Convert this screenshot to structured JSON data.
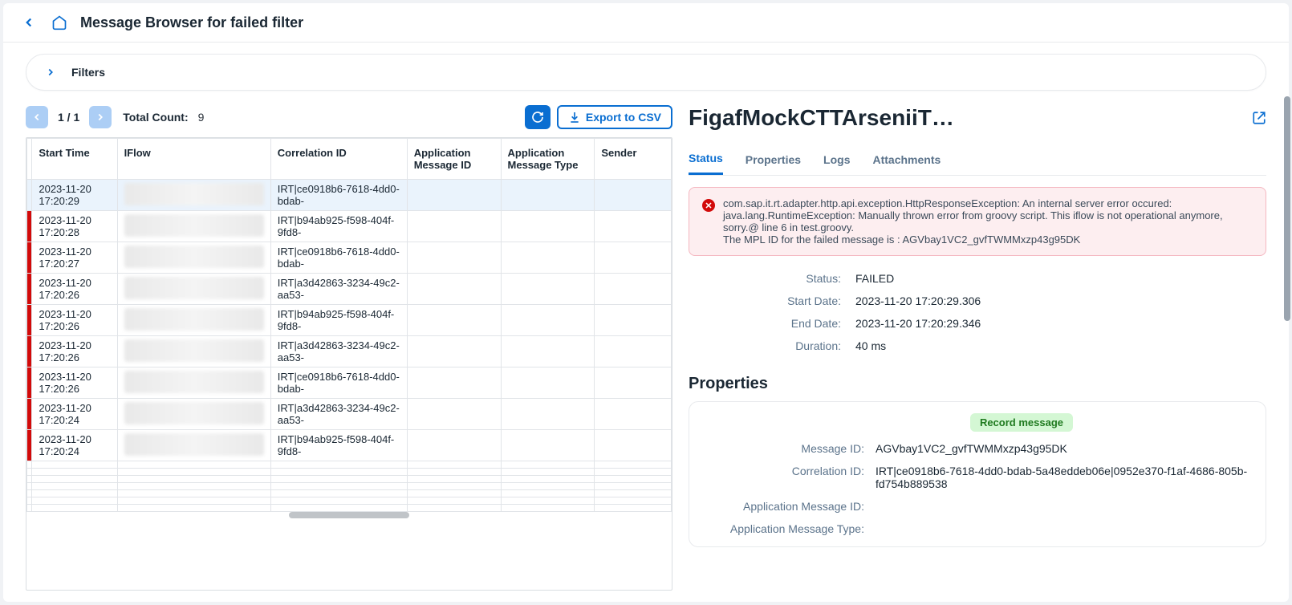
{
  "header": {
    "title": "Message Browser for failed filter"
  },
  "filters": {
    "label": "Filters"
  },
  "toolbar": {
    "pager": "1 / 1",
    "total_label": "Total Count:",
    "total_value": "9",
    "export_label": "Export to CSV"
  },
  "table": {
    "columns": [
      "Start Time",
      "IFlow",
      "Correlation ID",
      "Application Message ID",
      "Application Message Type",
      "Sender"
    ],
    "rows": [
      {
        "start": "2023-11-20 17:20:29",
        "corr": "IRT|ce0918b6-7618-4dd0-bdab-"
      },
      {
        "start": "2023-11-20 17:20:28",
        "corr": "IRT|b94ab925-f598-404f-9fd8-"
      },
      {
        "start": "2023-11-20 17:20:27",
        "corr": "IRT|ce0918b6-7618-4dd0-bdab-"
      },
      {
        "start": "2023-11-20 17:20:26",
        "corr": "IRT|a3d42863-3234-49c2-aa53-"
      },
      {
        "start": "2023-11-20 17:20:26",
        "corr": "IRT|b94ab925-f598-404f-9fd8-"
      },
      {
        "start": "2023-11-20 17:20:26",
        "corr": "IRT|a3d42863-3234-49c2-aa53-"
      },
      {
        "start": "2023-11-20 17:20:26",
        "corr": "IRT|ce0918b6-7618-4dd0-bdab-"
      },
      {
        "start": "2023-11-20 17:20:24",
        "corr": "IRT|a3d42863-3234-49c2-aa53-"
      },
      {
        "start": "2023-11-20 17:20:24",
        "corr": "IRT|b94ab925-f598-404f-9fd8-"
      }
    ]
  },
  "detail": {
    "title": "FigafMockCTTArseniiT…",
    "tabs": [
      "Status",
      "Properties",
      "Logs",
      "Attachments"
    ],
    "error": "com.sap.it.rt.adapter.http.api.exception.HttpResponseException: An internal server error occured: java.lang.RuntimeException: Manually thrown error from groovy script. This iflow is not operational anymore, sorry.@ line 6 in test.groovy.\nThe MPL ID for the failed message is : AGVbay1VC2_gvfTWMMxzp43g95DK",
    "status": {
      "status_label": "Status:",
      "status_value": "FAILED",
      "start_label": "Start Date:",
      "start_value": "2023-11-20 17:20:29.306",
      "end_label": "End Date:",
      "end_value": "2023-11-20 17:20:29.346",
      "duration_label": "Duration:",
      "duration_value": "40 ms"
    },
    "properties_title": "Properties",
    "record_label": "Record message",
    "props": {
      "msgid_label": "Message ID:",
      "msgid_value": "AGVbay1VC2_gvfTWMMxzp43g95DK",
      "corr_label": "Correlation ID:",
      "corr_value": "IRT|ce0918b6-7618-4dd0-bdab-5a48eddeb06e|0952e370-f1af-4686-805b-fd754b889538",
      "appid_label": "Application Message ID:",
      "appid_value": "",
      "apptype_label": "Application Message Type:",
      "apptype_value": ""
    }
  }
}
